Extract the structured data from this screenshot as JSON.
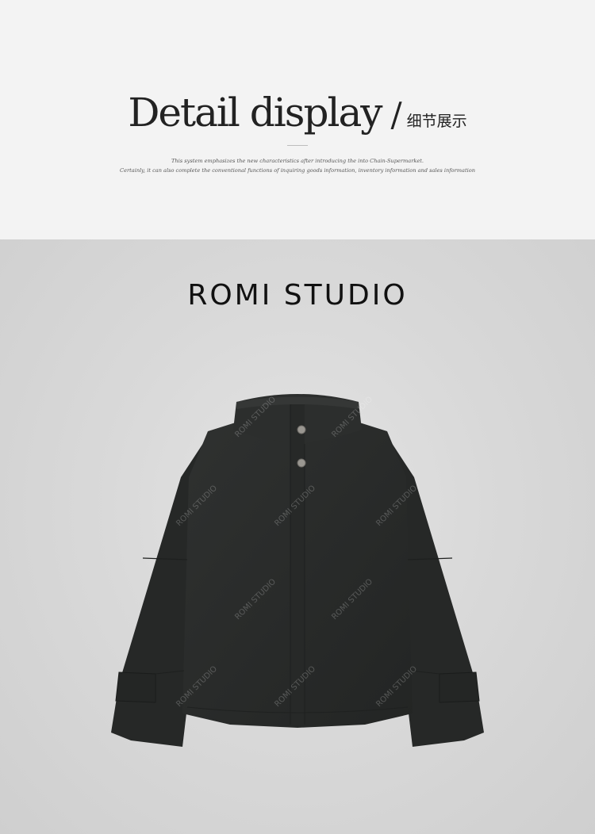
{
  "header": {
    "title_en": "Detail display",
    "slash": "/",
    "title_cn": "细节展示",
    "description_line1": "This system emphasizes the new characteristics after introducing the  into Chain-Supermarket.",
    "description_line2": "Certainly, it can also complete the conventional functions of inquiring goods information, inventory information and sales information"
  },
  "showcase": {
    "brand": "ROMI STUDIO",
    "watermark_text": "ROMI STUDIO",
    "product_icon": "jacket-icon"
  },
  "colors": {
    "header_bg": "#f3f3f3",
    "showcase_bg": "#d9d9d9",
    "jacket": "#2a2c2b",
    "text": "#222222"
  }
}
